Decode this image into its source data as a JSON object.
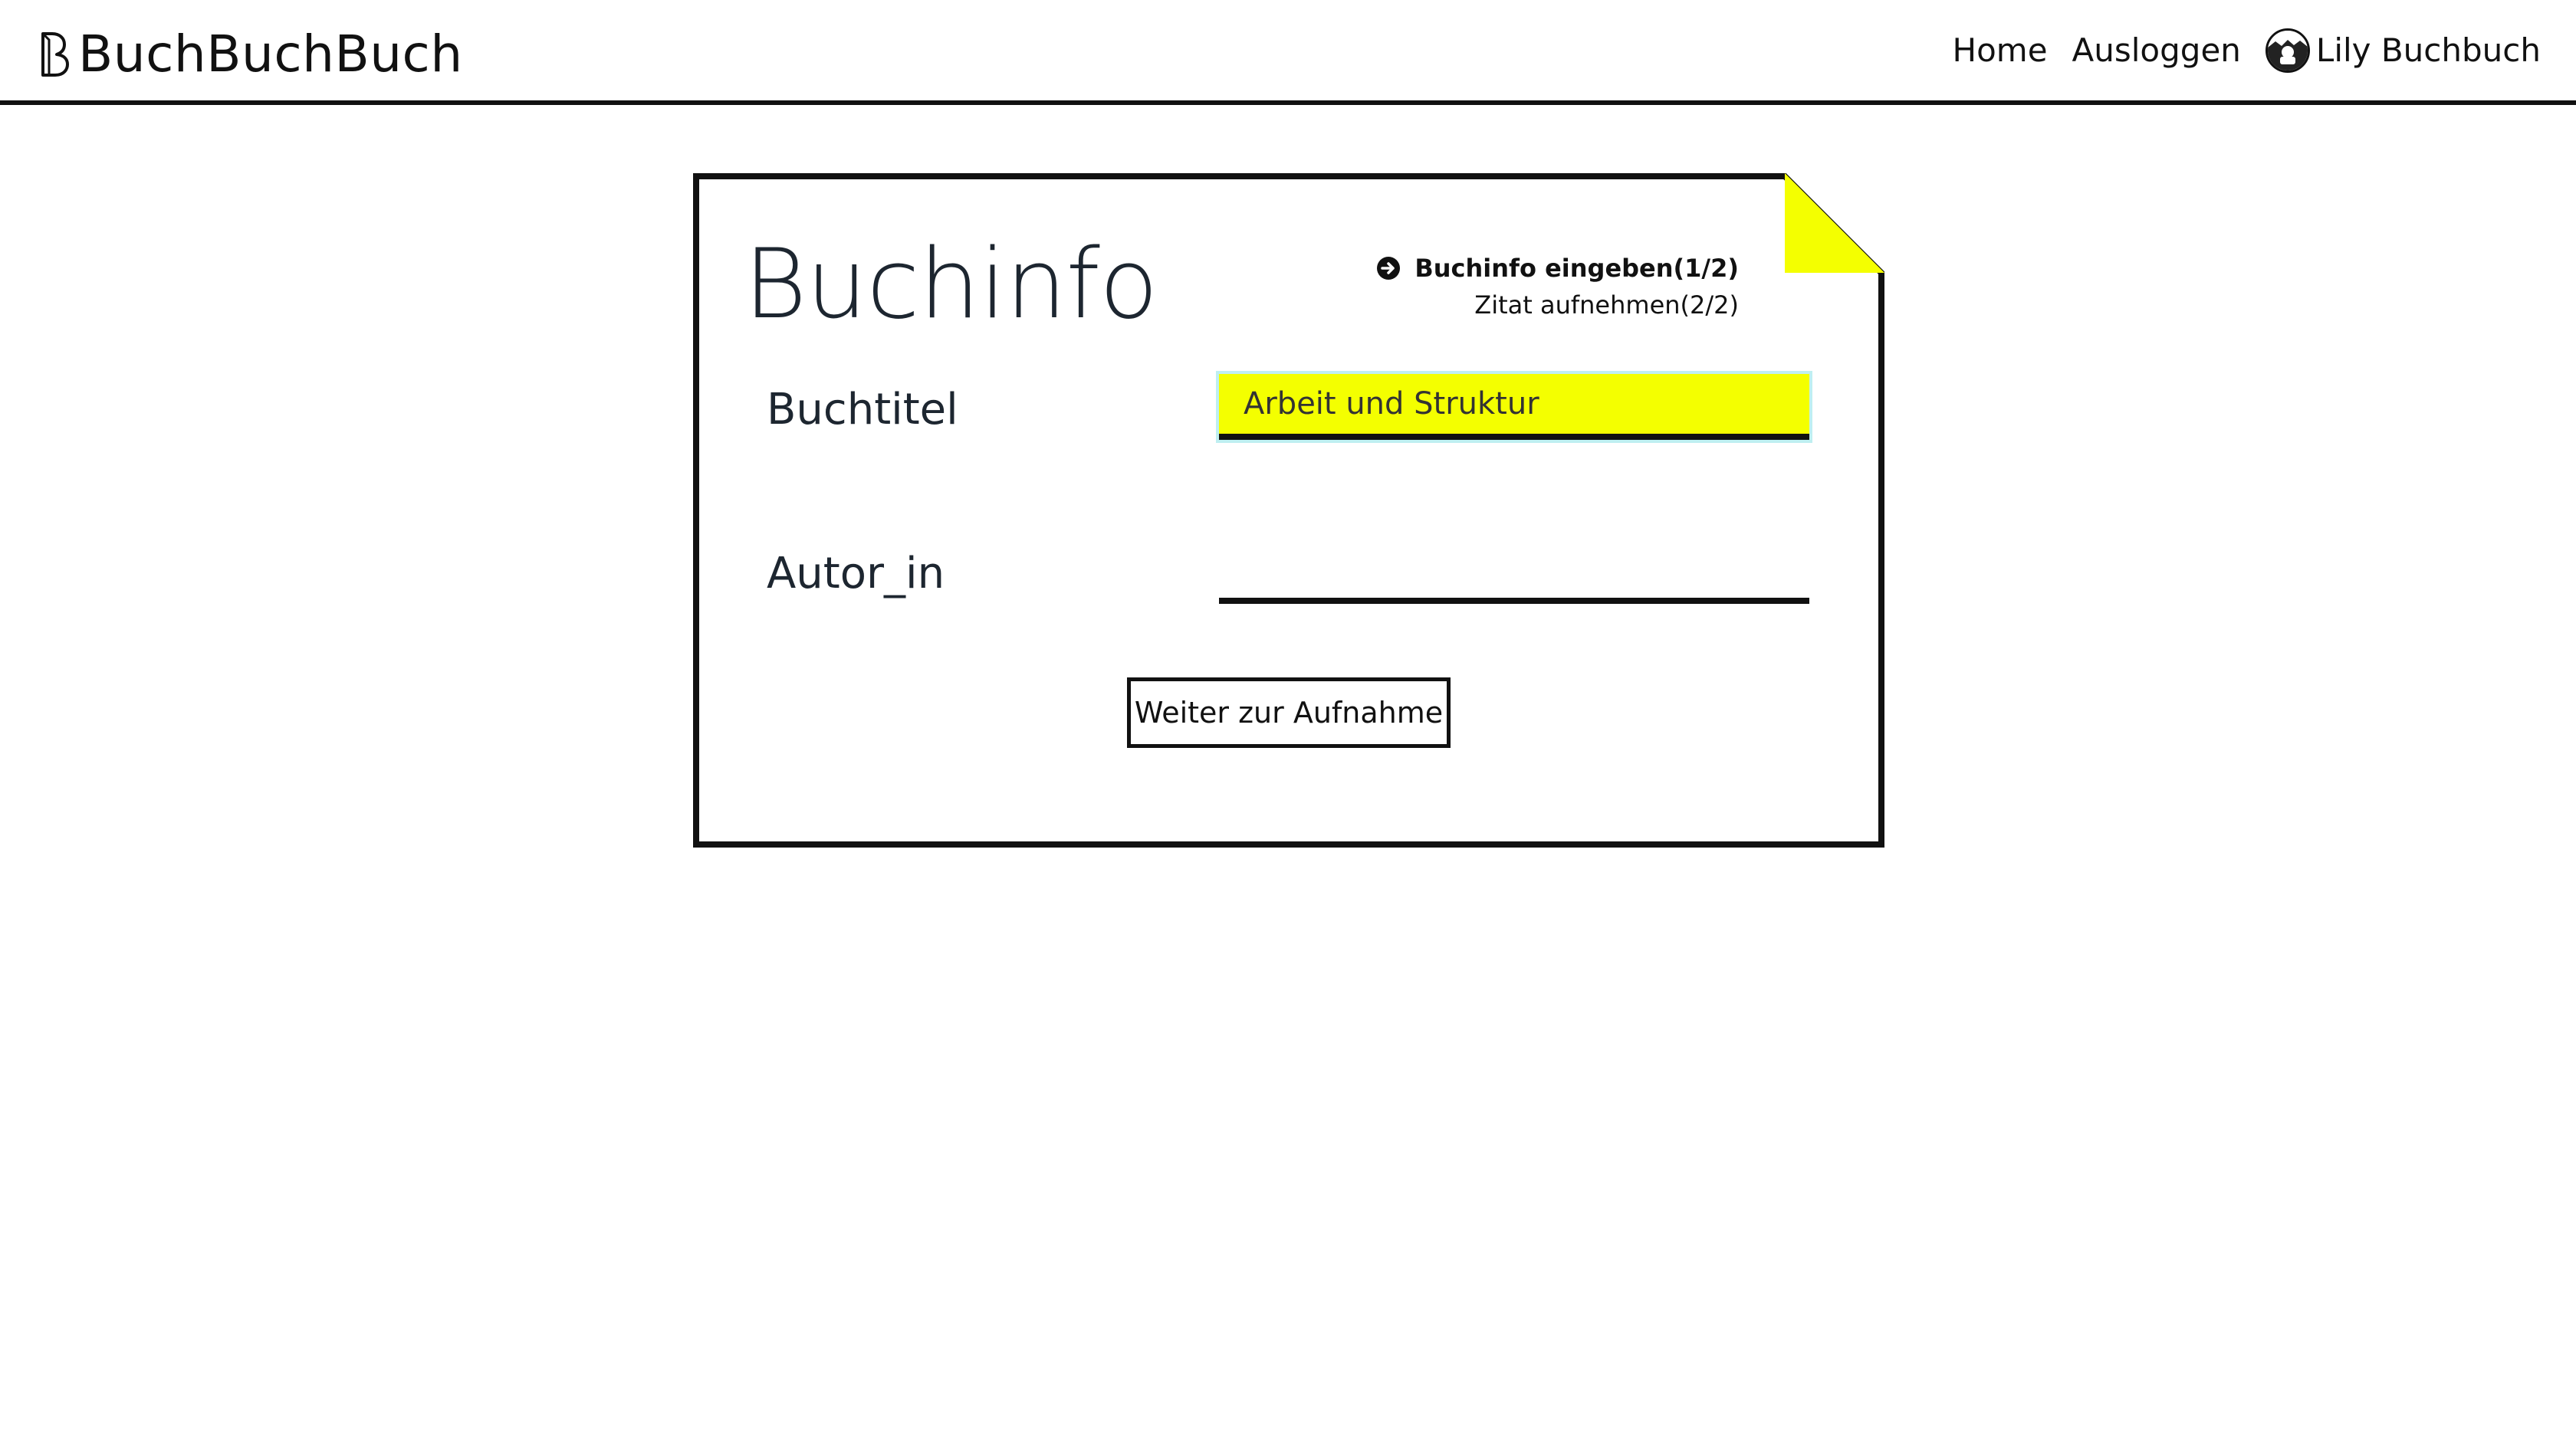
{
  "navbar": {
    "brand": "BuchBuchBuch",
    "home": "Home",
    "logout": "Ausloggen",
    "user_name": "Lily Buchbuch"
  },
  "card": {
    "title": "Buchinfo",
    "steps": [
      {
        "label": "Buchinfo eingeben(1/2)",
        "active": true
      },
      {
        "label": "Zitat aufnehmen(2/2)",
        "active": false
      }
    ],
    "fields": {
      "title_label": "Buchtitel",
      "title_value": "Arbeit und Struktur",
      "author_label": "Autor_in",
      "author_value": ""
    },
    "submit": "Weiter zur Aufnahme"
  },
  "colors": {
    "accent": "#f4ff00",
    "focus_ring": "#bfeff1",
    "ink": "#111111",
    "text": "#1d2630"
  },
  "icons": {
    "brand": "brand-logo-icon",
    "avatar": "avatar-icon",
    "active_step": "arrow-circle-right-icon"
  }
}
